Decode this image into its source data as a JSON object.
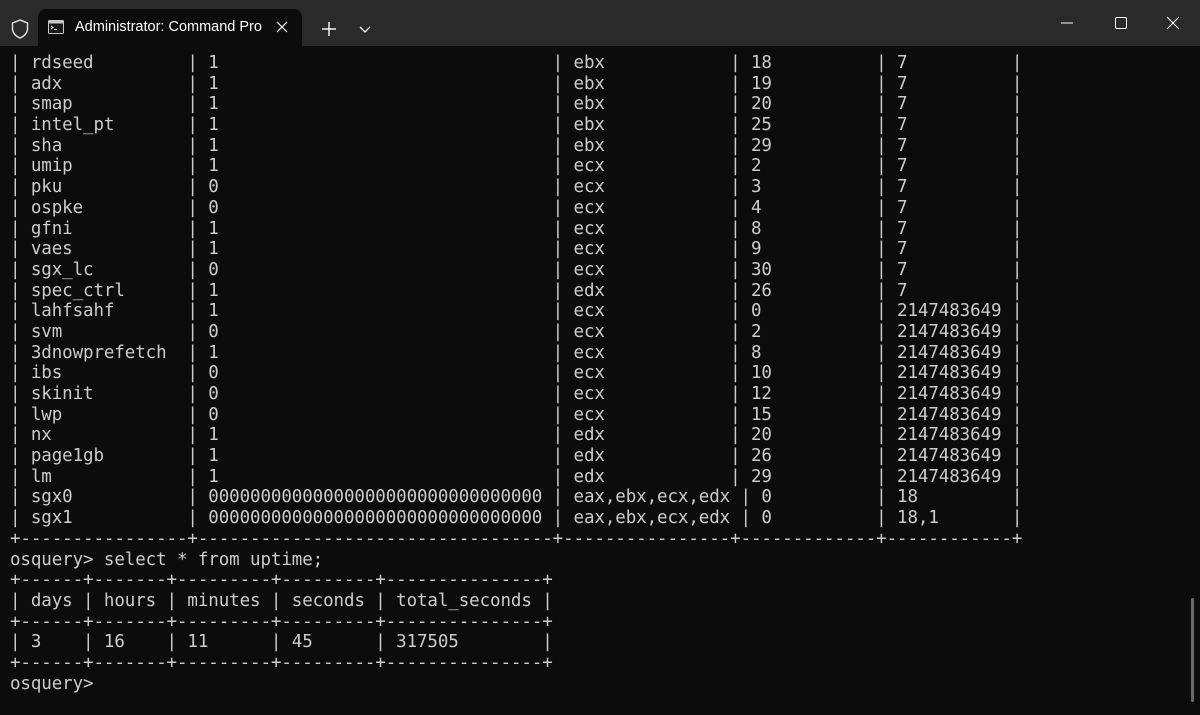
{
  "window": {
    "tab_title": "Administrator: Command Pro",
    "icons": {
      "shield": "shield-icon",
      "terminal": "terminal-icon",
      "close_tab": "close-icon",
      "new_tab": "plus-icon",
      "dropdown": "chevron-down-icon",
      "minimize": "minimize-icon",
      "maximize": "maximize-icon",
      "close_window": "close-icon"
    },
    "colors": {
      "titlebar": "#2a2a2a",
      "terminal_bg": "#0c0c0c",
      "terminal_fg": "#cccccc"
    }
  },
  "terminal": {
    "lines": [
      "| rdseed         | 1                                | ebx            | 18          | 7          |",
      "| adx            | 1                                | ebx            | 19          | 7          |",
      "| smap           | 1                                | ebx            | 20          | 7          |",
      "| intel_pt       | 1                                | ebx            | 25          | 7          |",
      "| sha            | 1                                | ebx            | 29          | 7          |",
      "| umip           | 1                                | ecx            | 2           | 7          |",
      "| pku            | 0                                | ecx            | 3           | 7          |",
      "| ospke          | 0                                | ecx            | 4           | 7          |",
      "| gfni           | 1                                | ecx            | 8           | 7          |",
      "| vaes           | 1                                | ecx            | 9           | 7          |",
      "| sgx_lc         | 0                                | ecx            | 30          | 7          |",
      "| spec_ctrl      | 1                                | edx            | 26          | 7          |",
      "| lahfsahf       | 1                                | ecx            | 0           | 2147483649 |",
      "| svm            | 0                                | ecx            | 2           | 2147483649 |",
      "| 3dnowprefetch  | 1                                | ecx            | 8           | 2147483649 |",
      "| ibs            | 0                                | ecx            | 10          | 2147483649 |",
      "| skinit         | 0                                | ecx            | 12          | 2147483649 |",
      "| lwp            | 0                                | ecx            | 15          | 2147483649 |",
      "| nx             | 1                                | edx            | 20          | 2147483649 |",
      "| page1gb        | 1                                | edx            | 26          | 2147483649 |",
      "| lm             | 1                                | edx            | 29          | 2147483649 |",
      "| sgx0           | 00000000000000000000000000000000 | eax,ebx,ecx,edx | 0          | 18         |",
      "| sgx1           | 00000000000000000000000000000000 | eax,ebx,ecx,edx | 0          | 18,1       |",
      "+----------------+----------------------------------+----------------+-------------+------------+",
      "osquery> select * from uptime;",
      "+------+-------+---------+---------+---------------+",
      "| days | hours | minutes | seconds | total_seconds |",
      "+------+-------+---------+---------+---------------+",
      "| 3    | 16    | 11      | 45      | 317505        |",
      "+------+-------+---------+---------+---------------+",
      "osquery>"
    ]
  }
}
